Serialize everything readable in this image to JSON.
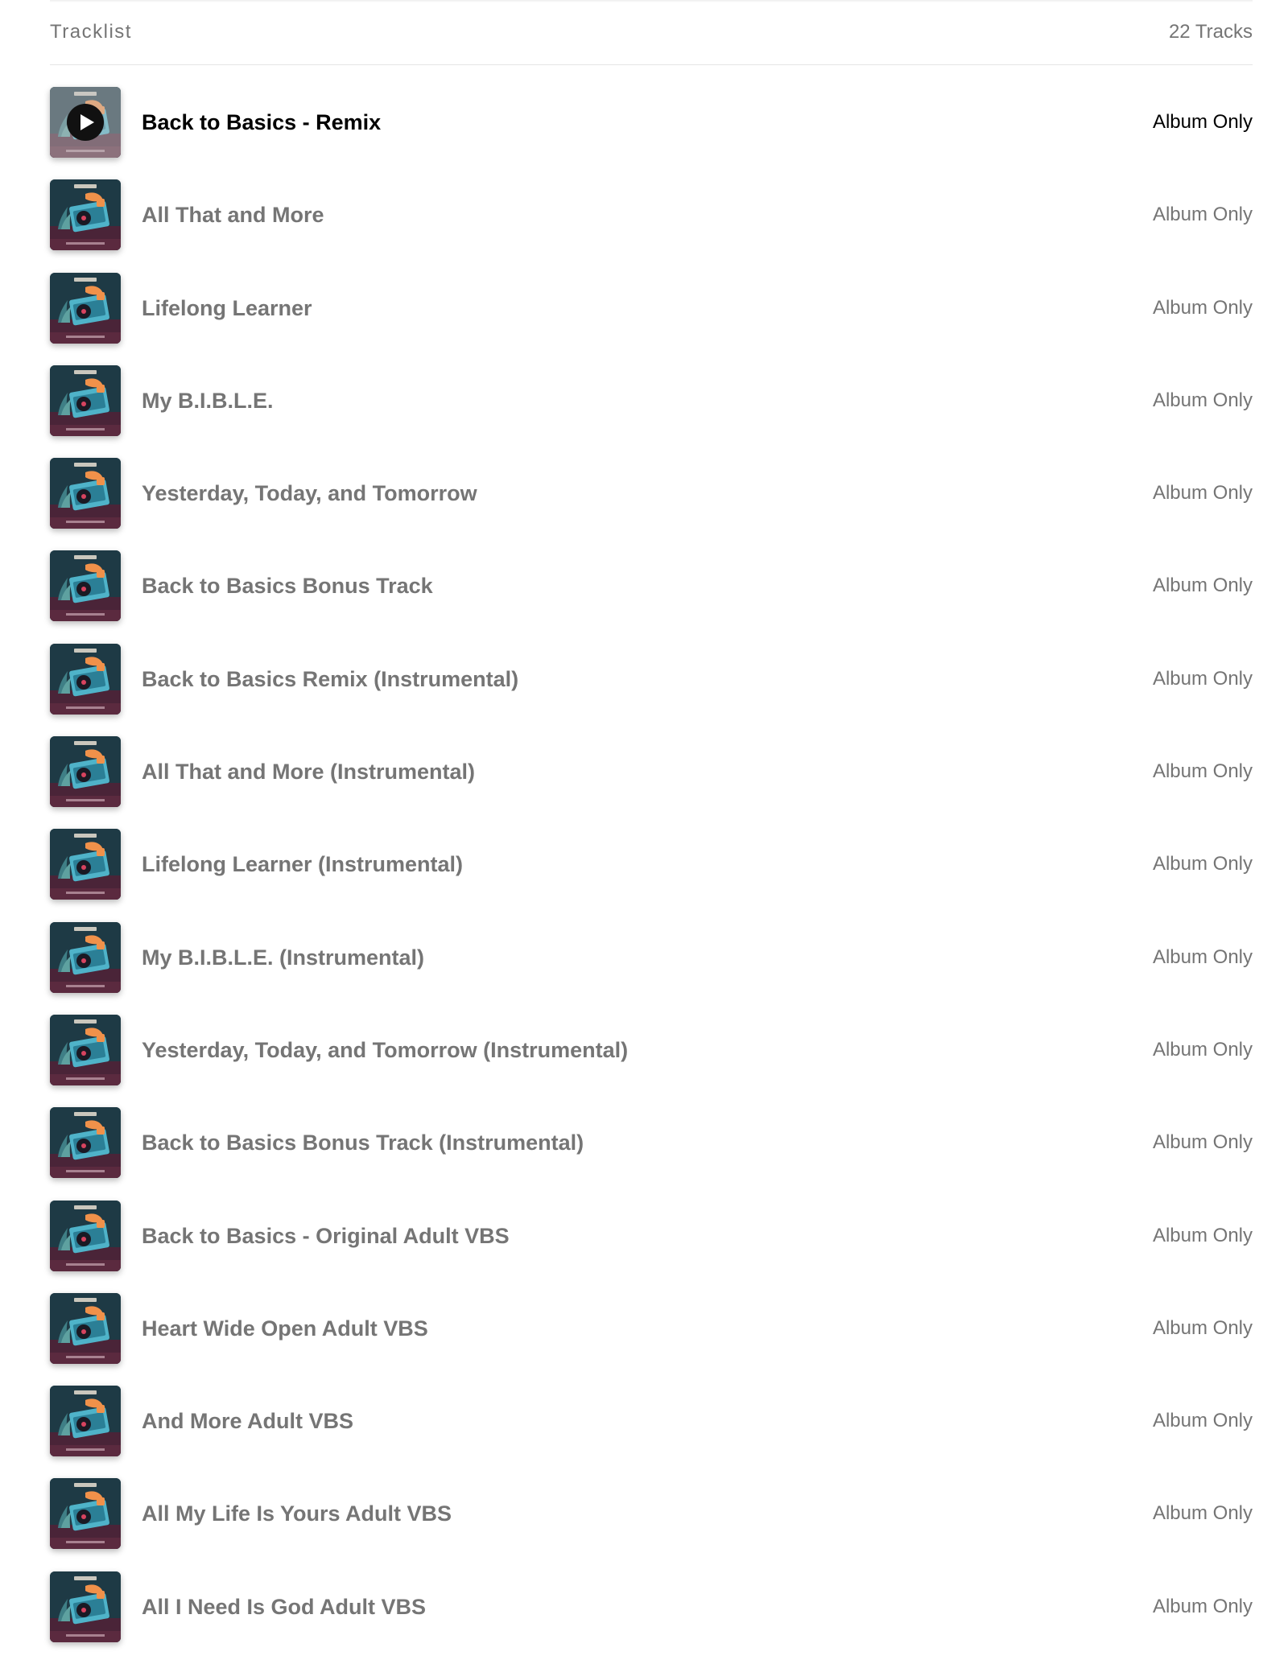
{
  "header": {
    "title": "Tracklist",
    "count": "22 Tracks"
  },
  "tracks": [
    {
      "title": "Back to Basics - Remix",
      "price": "Album Only"
    },
    {
      "title": "All That and More",
      "price": "Album Only"
    },
    {
      "title": "Lifelong Learner",
      "price": "Album Only"
    },
    {
      "title": "My B.I.B.L.E.",
      "price": "Album Only"
    },
    {
      "title": "Yesterday, Today, and Tomorrow",
      "price": "Album Only"
    },
    {
      "title": "Back to Basics Bonus Track",
      "price": "Album Only"
    },
    {
      "title": "Back to Basics Remix (Instrumental)",
      "price": "Album Only"
    },
    {
      "title": "All That and More (Instrumental)",
      "price": "Album Only"
    },
    {
      "title": "Lifelong Learner (Instrumental)",
      "price": "Album Only"
    },
    {
      "title": "My B.I.B.L.E. (Instrumental)",
      "price": "Album Only"
    },
    {
      "title": "Yesterday, Today, and Tomorrow (Instrumental)",
      "price": "Album Only"
    },
    {
      "title": "Back to Basics Bonus Track (Instrumental)",
      "price": "Album Only"
    },
    {
      "title": "Back to Basics - Original Adult VBS",
      "price": "Album Only"
    },
    {
      "title": "Heart Wide Open Adult VBS",
      "price": "Album Only"
    },
    {
      "title": "And More Adult VBS",
      "price": "Album Only"
    },
    {
      "title": "All My Life Is Yours Adult VBS",
      "price": "Album Only"
    },
    {
      "title": "All I Need Is God Adult VBS",
      "price": "Album Only"
    }
  ],
  "active_track": "Back to Basics - Remix",
  "play_icon": "play-icon",
  "colors": {
    "active_text": "#000000",
    "inactive_text": "#757575",
    "play_button": "#111111"
  }
}
